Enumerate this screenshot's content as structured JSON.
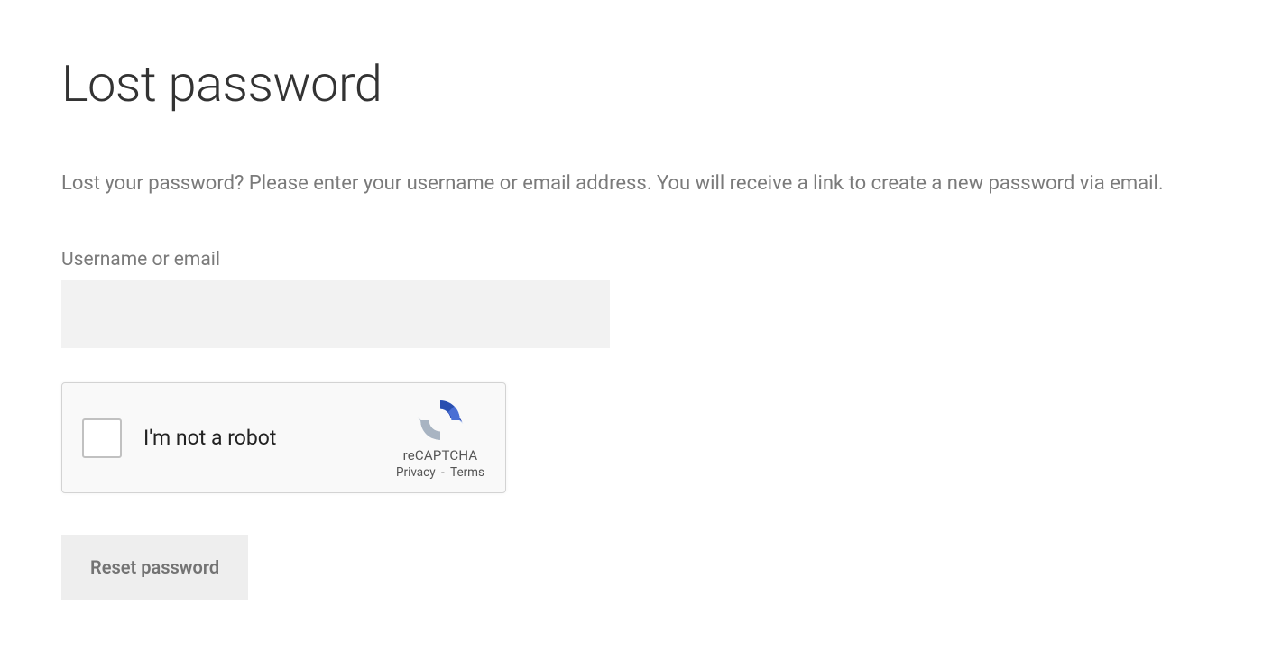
{
  "page": {
    "title": "Lost password",
    "instructions": "Lost your password? Please enter your username or email address. You will receive a link to create a new password via email."
  },
  "form": {
    "username_label": "Username or email",
    "username_value": "",
    "submit_label": "Reset password"
  },
  "recaptcha": {
    "checkbox_label": "I'm not a robot",
    "brand": "reCAPTCHA",
    "privacy_label": "Privacy",
    "terms_label": "Terms"
  }
}
